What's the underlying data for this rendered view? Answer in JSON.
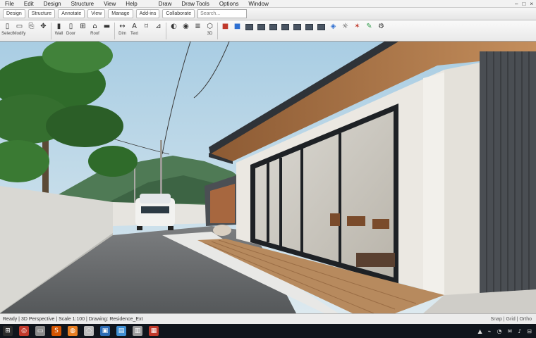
{
  "menu": {
    "items": [
      "File",
      "Edit",
      "Design",
      "Structure",
      "View",
      "Help",
      "Draw",
      "Draw Tools",
      "Options",
      "Window"
    ],
    "window_controls": [
      "–",
      "□",
      "×"
    ]
  },
  "tabs": [
    "Design",
    "Structure",
    "Annotate",
    "View",
    "Manage",
    "Add-ins",
    "Collaborate"
  ],
  "search": {
    "placeholder": "Search..."
  },
  "toolbar": {
    "groups": [
      [
        {
          "icon": "select-icon",
          "glyph": "▯",
          "label": "Select"
        },
        {
          "icon": "modify-icon",
          "glyph": "▭",
          "label": "Modify"
        },
        {
          "icon": "copy-icon",
          "glyph": "⎘",
          "label": ""
        },
        {
          "icon": "move-icon",
          "glyph": "✥",
          "label": ""
        }
      ],
      [
        {
          "icon": "wall-icon",
          "glyph": "▮",
          "label": "Wall"
        },
        {
          "icon": "door-icon",
          "glyph": "▯",
          "label": "Door"
        },
        {
          "icon": "window-icon",
          "glyph": "⊞",
          "label": ""
        },
        {
          "icon": "roof-icon",
          "glyph": "⌂",
          "label": "Roof"
        },
        {
          "icon": "floor-icon",
          "glyph": "▬",
          "label": ""
        }
      ],
      [
        {
          "icon": "dimension-icon",
          "glyph": "↔",
          "label": "Dim"
        },
        {
          "icon": "text-icon",
          "glyph": "A",
          "label": "Text"
        },
        {
          "icon": "tag-icon",
          "glyph": "⌑",
          "label": ""
        },
        {
          "icon": "section-icon",
          "glyph": "⊿",
          "label": ""
        }
      ],
      [
        {
          "icon": "render-icon",
          "glyph": "◐",
          "label": ""
        },
        {
          "icon": "camera-icon",
          "glyph": "◉",
          "label": ""
        },
        {
          "icon": "layer-icon",
          "glyph": "≣",
          "label": ""
        },
        {
          "icon": "view-3d-icon",
          "glyph": "⬡",
          "label": "3D"
        }
      ]
    ],
    "right_icons": [
      {
        "icon": "color-red-icon",
        "glyph": "■",
        "tone": "red"
      },
      {
        "icon": "color-blue-icon",
        "glyph": "■",
        "tone": "blu"
      },
      {
        "icon": "grid-a-icon",
        "glyph": "▦",
        "tone": "blk"
      },
      {
        "icon": "grid-b-icon",
        "glyph": "▦",
        "tone": "blk"
      },
      {
        "icon": "grid-c-icon",
        "glyph": "▦",
        "tone": "blk"
      },
      {
        "icon": "grid-d-icon",
        "glyph": "▦",
        "tone": "blk"
      },
      {
        "icon": "grid-e-icon",
        "glyph": "▦",
        "tone": "blk"
      },
      {
        "icon": "grid-f-icon",
        "glyph": "▦",
        "tone": "blk"
      },
      {
        "icon": "grid-g-icon",
        "glyph": "▦",
        "tone": "blk"
      },
      {
        "icon": "material-icon",
        "glyph": "◈",
        "tone": "blu"
      },
      {
        "icon": "light-icon",
        "glyph": "☼",
        "tone": ""
      },
      {
        "icon": "sun-icon",
        "glyph": "✶",
        "tone": "red"
      },
      {
        "icon": "paint-icon",
        "glyph": "✎",
        "tone": "grn"
      },
      {
        "icon": "settings-icon",
        "glyph": "⚙",
        "tone": ""
      }
    ]
  },
  "status": {
    "left": "Ready | 3D Perspective | Scale 1:100 | Drawing: Residence_Ext",
    "right": "Snap | Grid | Ortho"
  },
  "taskbar": {
    "apps": [
      {
        "icon": "start-icon",
        "glyph": "⊞",
        "color": "#2b2b2b"
      },
      {
        "icon": "browser-icon",
        "glyph": "◎",
        "color": "#c0392b"
      },
      {
        "icon": "folder-icon",
        "glyph": "▭",
        "color": "#8c8c8c"
      },
      {
        "icon": "app-s-icon",
        "glyph": "S",
        "color": "#d35400"
      },
      {
        "icon": "firefox-icon",
        "glyph": "◍",
        "color": "#e67e22"
      },
      {
        "icon": "chrome-icon",
        "glyph": "◌",
        "color": "#bdbdbd"
      },
      {
        "icon": "cad-icon",
        "glyph": "▣",
        "color": "#2d6cb5"
      },
      {
        "icon": "photo-icon",
        "glyph": "▤",
        "color": "#3f8fd2"
      },
      {
        "icon": "doc-icon",
        "glyph": "▥",
        "color": "#9c9c9c"
      },
      {
        "icon": "pdf-icon",
        "glyph": "▦",
        "color": "#c0392b"
      }
    ],
    "tray": [
      "▲",
      "⌁",
      "◔",
      "✉",
      "♪",
      "⊟"
    ]
  },
  "scene": {
    "sky": "#b9d6e6",
    "wall_color": "#e9e6e0",
    "wood_color": "#b07a4c",
    "fascia_color": "#2f3338",
    "cladding_color": "#4a4e53",
    "road_color": "#6b6d6f"
  }
}
